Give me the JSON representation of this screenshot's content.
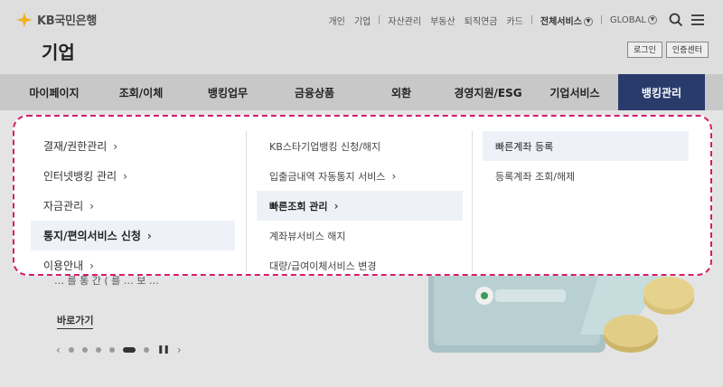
{
  "brand": {
    "logo_text": "KB국민은행"
  },
  "page_title": "기업",
  "util_nav": {
    "links": [
      "개인",
      "기업",
      "자산관리",
      "부동산",
      "퇴직연금",
      "카드"
    ],
    "all_services": "전체서비스",
    "global": "GLOBAL",
    "login": "로그인",
    "cert_center": "인증센터"
  },
  "gnb": {
    "items": [
      "마이페이지",
      "조회/이체",
      "뱅킹업무",
      "금융상품",
      "외환",
      "경영지원/ESG",
      "기업서비스",
      "뱅킹관리"
    ],
    "active_index": 7
  },
  "mega_menu": {
    "col1": [
      "결재/권한관리",
      "인터넷뱅킹 관리",
      "자금관리",
      "통지/편의서비스 신청",
      "이용안내"
    ],
    "col2": [
      "KB스타기업뱅킹 신청/해지",
      "입출금내역 자동통지 서비스",
      "빠른조회 관리",
      "계좌뷰서비스 해지",
      "대량/급여이체서비스 변경"
    ],
    "col3": [
      "빠른계좌 등록",
      "등록계좌 조회/해제"
    ]
  },
  "banner": {
    "partial_text": "… 를 통 간 ( 를 … 보 …",
    "more_link": "바로가기"
  },
  "colors": {
    "active_nav": "#283b6b",
    "highlight_border": "#d21d6a",
    "selected_bg": "#eef2f8"
  }
}
